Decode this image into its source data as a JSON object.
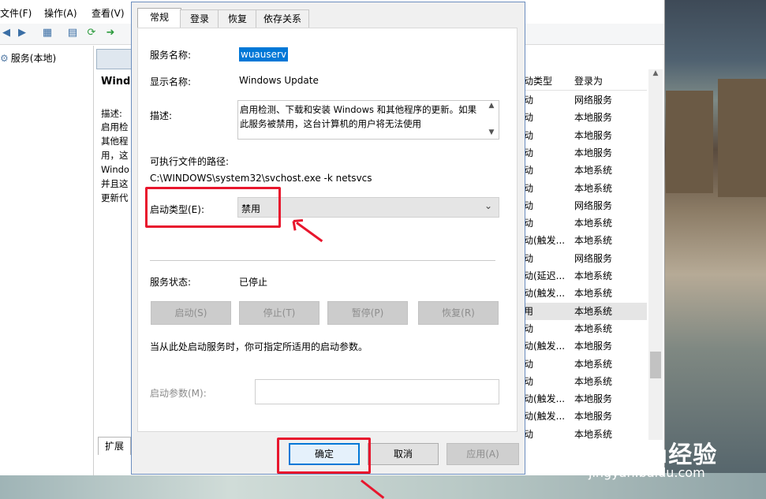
{
  "mmc": {
    "menu": [
      "文件(F)",
      "操作(A)",
      "查看(V)"
    ],
    "tree_item": "服务(本地)",
    "desc_pane": {
      "title": "Windo",
      "lines": [
        "描述:",
        "启用检",
        "其他程",
        "用，这",
        "Windo",
        "并且这",
        "更新代"
      ]
    },
    "extended_tab": "扩展",
    "list": {
      "headers": [
        "动类型",
        "登录为"
      ],
      "rows": [
        {
          "type": "动",
          "logon": "网络服务"
        },
        {
          "type": "动",
          "logon": "本地服务"
        },
        {
          "type": "动",
          "logon": "本地服务"
        },
        {
          "type": "动",
          "logon": "本地服务"
        },
        {
          "type": "动",
          "logon": "本地系统"
        },
        {
          "type": "动",
          "logon": "本地系统"
        },
        {
          "type": "动",
          "logon": "网络服务"
        },
        {
          "type": "动",
          "logon": "本地系统"
        },
        {
          "type": "动(触发...",
          "logon": "本地系统"
        },
        {
          "type": "动",
          "logon": "网络服务"
        },
        {
          "type": "动(延迟...",
          "logon": "本地系统"
        },
        {
          "type": "动(触发...",
          "logon": "本地系统"
        },
        {
          "type": "用",
          "logon": "本地系统"
        },
        {
          "type": "动",
          "logon": "本地系统"
        },
        {
          "type": "动(触发...",
          "logon": "本地服务"
        },
        {
          "type": "动",
          "logon": "本地系统"
        },
        {
          "type": "动",
          "logon": "本地系统"
        },
        {
          "type": "动(触发...",
          "logon": "本地服务"
        },
        {
          "type": "动(触发...",
          "logon": "本地服务"
        },
        {
          "type": "动",
          "logon": "本地系统"
        }
      ]
    }
  },
  "dialog": {
    "tabs": [
      "常规",
      "登录",
      "恢复",
      "依存关系"
    ],
    "service_name_label": "服务名称:",
    "service_name": "wuauserv",
    "display_name_label": "显示名称:",
    "display_name": "Windows Update",
    "description_label": "描述:",
    "description": "启用检测、下载和安装 Windows 和其他程序的更新。如果此服务被禁用，这台计算机的用户将无法使用",
    "exe_path_label": "可执行文件的路径:",
    "exe_path": "C:\\WINDOWS\\system32\\svchost.exe -k netsvcs",
    "startup_type_label": "启动类型(E):",
    "startup_type": "禁用",
    "service_status_label": "服务状态:",
    "service_status": "已停止",
    "buttons": {
      "start": "启动(S)",
      "stop": "停止(T)",
      "pause": "暂停(P)",
      "resume": "恢复(R)"
    },
    "hint": "当从此处启动服务时，你可指定所适用的启动参数。",
    "start_params_label": "启动参数(M):",
    "start_params_value": "",
    "ok": "确定",
    "cancel": "取消",
    "apply": "应用(A)"
  },
  "watermark": {
    "logo": "Baidu经验",
    "url": "jingyan.baidu.com"
  },
  "colors": {
    "annotation_red": "#e8162d",
    "selection_blue": "#0078d7"
  }
}
